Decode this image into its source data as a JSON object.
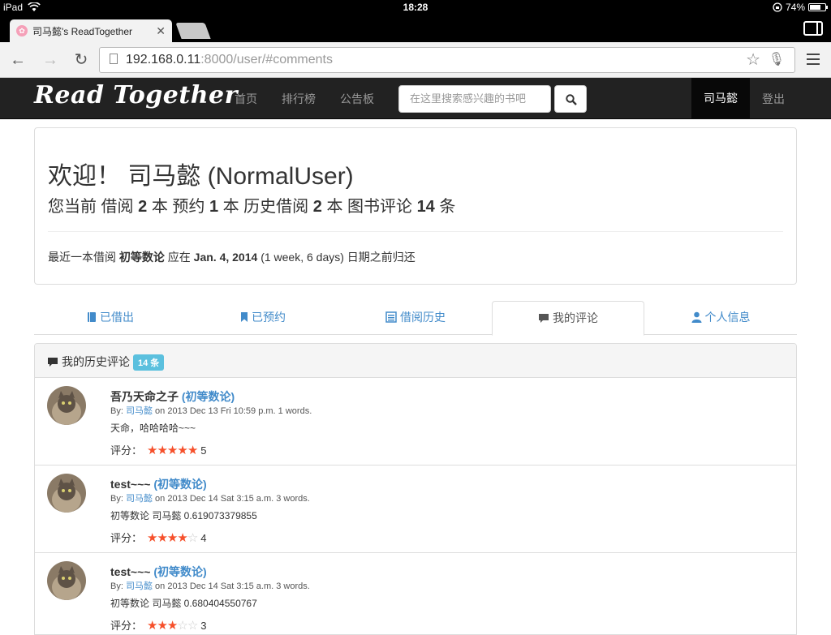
{
  "status_bar": {
    "device": "iPad",
    "time": "18:28",
    "battery": "74%",
    "battery_level": 0.74
  },
  "browser": {
    "tab_title": "司马懿's ReadTogether",
    "url_host": "192.168.0.11",
    "url_rest": ":8000/user/#comments"
  },
  "nav": {
    "brand": "Read Together",
    "links": [
      "首页",
      "排行榜",
      "公告板"
    ],
    "search_placeholder": "在这里搜索感兴趣的书吧",
    "user": "司马懿",
    "logout": "登出"
  },
  "welcome": {
    "greeting": "欢迎！ 司马懿 (NormalUser)",
    "stats": {
      "prefix": "您当前 借阅",
      "borrowed": "2",
      "t1": "本 预约",
      "reserved": "1",
      "t2": "本 历史借阅",
      "history": "2",
      "t3": "本 图书评论",
      "comments": "14",
      "t4": "条"
    },
    "note": {
      "prefix": "最近一本借阅",
      "book": "初等数论",
      "mid": "应在",
      "date": "Jan. 4, 2014",
      "suffix": "(1 week, 6 days) 日期之前归还"
    }
  },
  "tabs": [
    "已借出",
    "已预约",
    "借阅历史",
    "我的评论",
    "个人信息"
  ],
  "active_tab": "我的评论",
  "comments_panel": {
    "heading": "我的历史评论",
    "badge": "14 条",
    "rating_label": "评分：",
    "by_label": "By:",
    "items": [
      {
        "title": "吾乃天命之子",
        "book": "(初等数论)",
        "author": "司马懿",
        "meta": "on 2013 Dec 13 Fri 10:59 p.m. 1 words.",
        "body": "天命，哈哈哈哈~~~",
        "rating": "5",
        "stars": 5
      },
      {
        "title": "test~~~",
        "book": "(初等数论)",
        "author": "司马懿",
        "meta": "on 2013 Dec 14 Sat 3:15 a.m. 3 words.",
        "body": "初等数论 司马懿 0.619073379855",
        "rating": "4",
        "stars": 4
      },
      {
        "title": "test~~~",
        "book": "(初等数论)",
        "author": "司马懿",
        "meta": "on 2013 Dec 14 Sat 3:15 a.m. 3 words.",
        "body": "初等数论 司马懿 0.680404550767",
        "rating": "3",
        "stars": 3
      }
    ]
  }
}
